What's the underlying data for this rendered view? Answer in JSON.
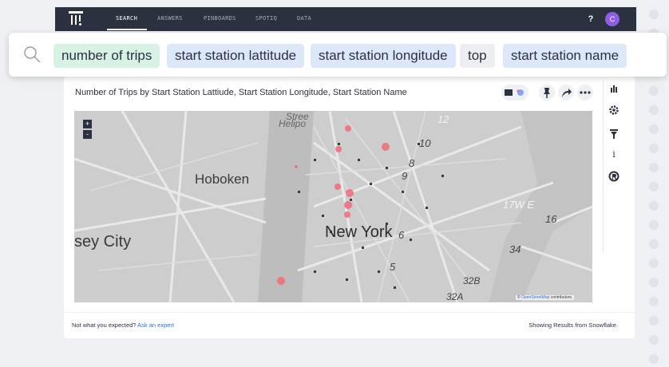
{
  "nav": {
    "tabs": [
      "SEARCH",
      "ANSWERS",
      "PINBOARDS",
      "SPOTIQ",
      "DATA"
    ],
    "active_tab": "SEARCH",
    "help_label": "?",
    "avatar_initial": "C",
    "avatar_color": "#8f5de8"
  },
  "search": {
    "tokens": [
      {
        "text": "number of trips",
        "kind": "measure"
      },
      {
        "text": "start station lattitude",
        "kind": "attribute"
      },
      {
        "text": "start station longitude",
        "kind": "attribute"
      },
      {
        "text": "top",
        "kind": "keyword"
      },
      {
        "text": "start station name",
        "kind": "attribute"
      }
    ],
    "token_colors": {
      "measure": "#d7f1e4",
      "attribute": "#dde7fa",
      "keyword": "#eceef1"
    }
  },
  "chart": {
    "title": "Number of Trips by Start Station Lattiude, Start Station Longitude, Start Station Name",
    "toolbar_icons": [
      "table-chart-toggle-icon",
      "pin-icon",
      "share-icon",
      "more-icon"
    ]
  },
  "map": {
    "labels": [
      "Hoboken",
      "sey City",
      "New York",
      "12",
      "10",
      "8",
      "9",
      "6",
      "5",
      "17W E",
      "16",
      "34",
      "32B",
      "32A",
      "Stree",
      "Helipo"
    ],
    "zoom_in": "+",
    "zoom_out": "-",
    "attribution_prefix": "©",
    "attribution_link": "OpenStreetMap",
    "attribution_suffix": "contributors."
  },
  "side_tools": [
    "chart-type-icon",
    "settings-icon",
    "filter-icon",
    "info-icon",
    "spotiq-icon"
  ],
  "footer": {
    "question": "Not what you expected?",
    "link": "Ask an expert",
    "source": "Showing Results from Snowflake."
  }
}
